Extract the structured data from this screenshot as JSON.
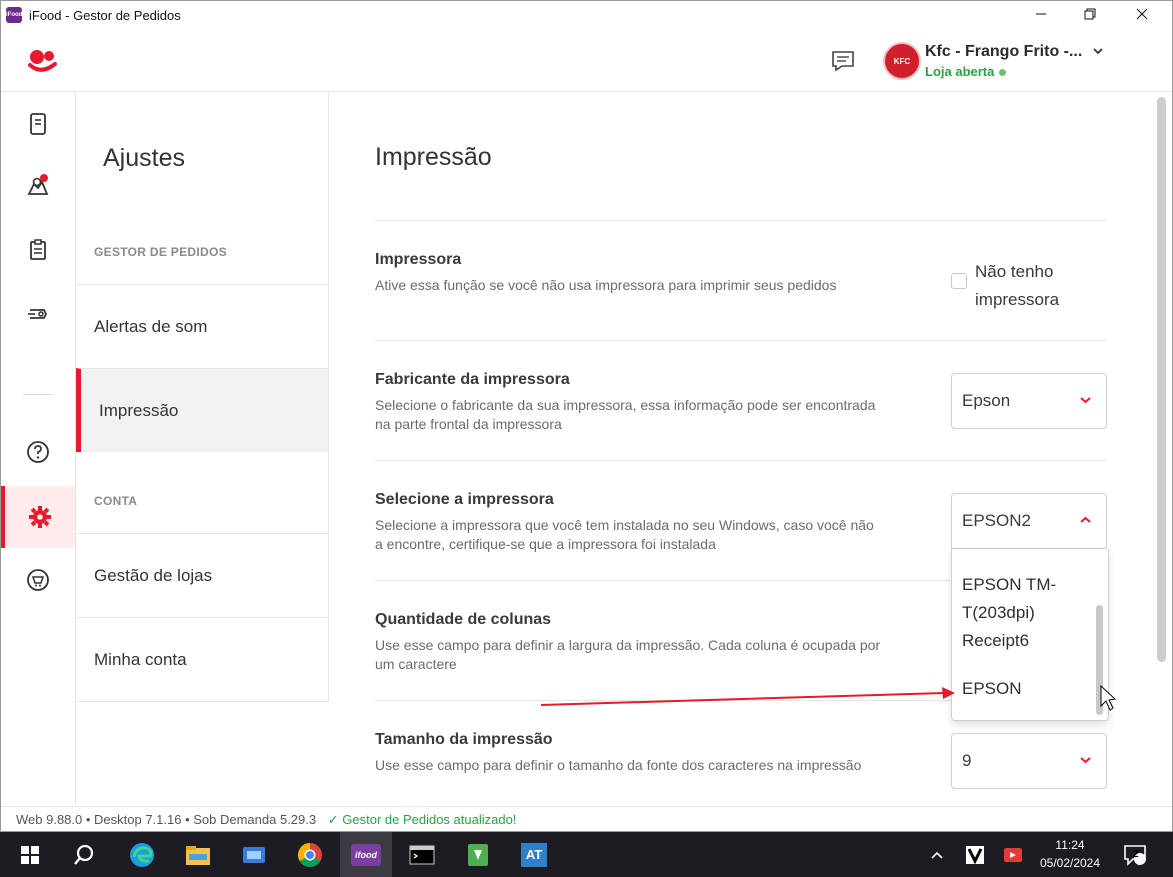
{
  "window": {
    "title": "iFood - Gestor de Pedidos",
    "minimize_icon": "minimize-icon",
    "maximize_icon": "restore-icon",
    "close_icon": "close-icon"
  },
  "header": {
    "store_name": "Kfc - Frango Frito -...",
    "store_status": "Loja aberta",
    "store_logo_text": "KFC",
    "app_logo_text": "iFood"
  },
  "rail": {
    "items": [
      "orders-icon",
      "map-icon",
      "menu-icon",
      "promotions-icon",
      "help-icon",
      "settings-icon",
      "marketplace-icon"
    ]
  },
  "settings_nav": {
    "title": "Ajustes",
    "section1": "GESTOR DE PEDIDOS",
    "items1": [
      "Alertas de som",
      "Impressão"
    ],
    "section2": "CONTA",
    "items2": [
      "Gestão de lojas",
      "Minha conta"
    ]
  },
  "main": {
    "title": "Impressão",
    "rows": [
      {
        "title": "Impressora",
        "desc": "Ative essa função se você não usa impressora para imprimir seus pedidos",
        "checkbox_label": "Não tenho impressora"
      },
      {
        "title": "Fabricante da impressora",
        "desc": "Selecione o fabricante da sua impressora, essa informação pode ser encontrada na parte frontal da impressora",
        "value": "Epson"
      },
      {
        "title": "Selecione a impressora",
        "desc": "Selecione a impressora que você tem instalada no seu Windows, caso você não a encontre, certifique-se que a impressora foi instalada",
        "value": "EPSON2"
      },
      {
        "title": "Quantidade de colunas",
        "desc": "Use esse campo para definir a largura da impressão. Cada coluna é ocupada por um caractere"
      },
      {
        "title": "Tamanho da impressão",
        "desc": "Use esse campo para definir o tamanho da fonte dos caracteres na impressão",
        "value": "9"
      }
    ],
    "dropdown_options": [
      "EPSON TM-T(203dpi) Receipt6",
      "EPSON"
    ]
  },
  "statusbar": {
    "versions": "Web 9.88.0  •  Desktop 7.1.16  •  Sob Demanda 5.29.3",
    "updated": "✓ Gestor de Pedidos atualizado!"
  },
  "taskbar": {
    "time": "11:24",
    "date": "05/02/2024",
    "notifications": "2",
    "apps": [
      "windows-start-icon",
      "search-icon",
      "edge-icon",
      "file-explorer-icon",
      "app-icon",
      "chrome-icon",
      "ifood-icon",
      "terminal-icon",
      "app-green-icon",
      "at-icon"
    ],
    "ifood_label": "ifood",
    "at_label": "AT"
  }
}
